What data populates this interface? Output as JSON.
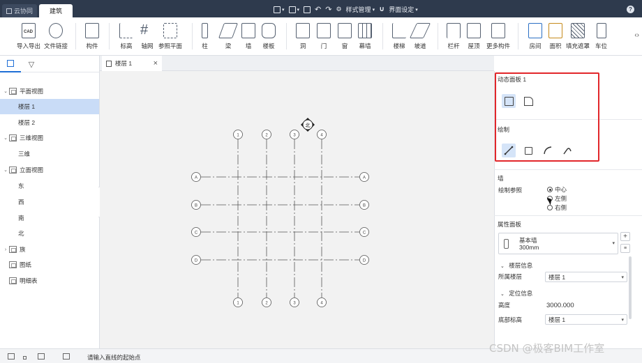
{
  "titlebar": {
    "tab_cloud": "云协同",
    "tab_building": "建筑",
    "style_manage": "样式管理",
    "ui_settings": "界面设定"
  },
  "ribbon": {
    "items": [
      {
        "label": "导入导出",
        "icon": "cad-icon"
      },
      {
        "label": "文件链接",
        "icon": "link-icon"
      },
      {
        "label": "构件",
        "icon": "component-icon"
      },
      {
        "label": "标高",
        "icon": "level-icon"
      },
      {
        "label": "轴网",
        "icon": "grid-icon"
      },
      {
        "label": "参照平面",
        "icon": "ref-plane-icon"
      },
      {
        "label": "柱",
        "icon": "column-icon"
      },
      {
        "label": "梁",
        "icon": "beam-icon"
      },
      {
        "label": "墙",
        "icon": "wall-icon"
      },
      {
        "label": "楼板",
        "icon": "floor-icon"
      },
      {
        "label": "洞",
        "icon": "opening-icon"
      },
      {
        "label": "门",
        "icon": "door-icon"
      },
      {
        "label": "窗",
        "icon": "window-icon"
      },
      {
        "label": "幕墙",
        "icon": "curtain-wall-icon"
      },
      {
        "label": "楼梯",
        "icon": "stair-icon"
      },
      {
        "label": "坡道",
        "icon": "ramp-icon"
      },
      {
        "label": "栏杆",
        "icon": "railing-icon"
      },
      {
        "label": "屋顶",
        "icon": "roof-icon"
      },
      {
        "label": "更多构件",
        "icon": "more-components-icon"
      },
      {
        "label": "房间",
        "icon": "room-icon"
      },
      {
        "label": "面积",
        "icon": "area-icon"
      },
      {
        "label": "填充遮罩",
        "icon": "fill-mask-icon"
      },
      {
        "label": "车位",
        "icon": "parking-icon"
      }
    ]
  },
  "tree": {
    "items": [
      {
        "label": "平面视图",
        "level": 0,
        "expanded": true
      },
      {
        "label": "楼层 1",
        "level": 1,
        "selected": true
      },
      {
        "label": "楼层 2",
        "level": 1
      },
      {
        "label": "三维视图",
        "level": 0,
        "expanded": true
      },
      {
        "label": "三维",
        "level": 1
      },
      {
        "label": "立面视图",
        "level": 0,
        "expanded": true
      },
      {
        "label": "东",
        "level": 1
      },
      {
        "label": "西",
        "level": 1
      },
      {
        "label": "南",
        "level": 1
      },
      {
        "label": "北",
        "level": 1
      },
      {
        "label": "族",
        "level": 0,
        "expanded": false
      },
      {
        "label": "图纸",
        "level": 0
      },
      {
        "label": "明细表",
        "level": 0
      }
    ]
  },
  "doc_tab": {
    "label": "楼层 1"
  },
  "canvas": {
    "north_label": "北",
    "vertical_axes": [
      "1",
      "2",
      "3",
      "4"
    ],
    "horizontal_axes": [
      "A",
      "B",
      "C",
      "D"
    ]
  },
  "right": {
    "dynamic_panel_title": "动态面板 1",
    "draw_title": "绘制",
    "wall_title": "墙",
    "draw_ref_label": "绘制参照",
    "draw_ref_options": [
      "中心",
      "左侧",
      "右侧"
    ],
    "draw_ref_selected": "中心",
    "props_title": "属性面板",
    "wall_type_name": "基本墙",
    "wall_type_size": "300mm",
    "floor_info_title": "楼层信息",
    "floor_label": "所属楼层",
    "floor_value": "楼层 1",
    "position_title": "定位信息",
    "height_label": "高度",
    "height_value": "3000.000",
    "base_label": "底部标高",
    "base_value": "楼层 1"
  },
  "status": {
    "hint": "请输入直线的起始点",
    "watermark": "CSDN @极客BIM工作室"
  },
  "colors": {
    "titlebar": "#2e3a4d",
    "accent": "#1f6fd6",
    "highlight_box": "#e2262a",
    "selected_row": "#c9dcf7"
  }
}
